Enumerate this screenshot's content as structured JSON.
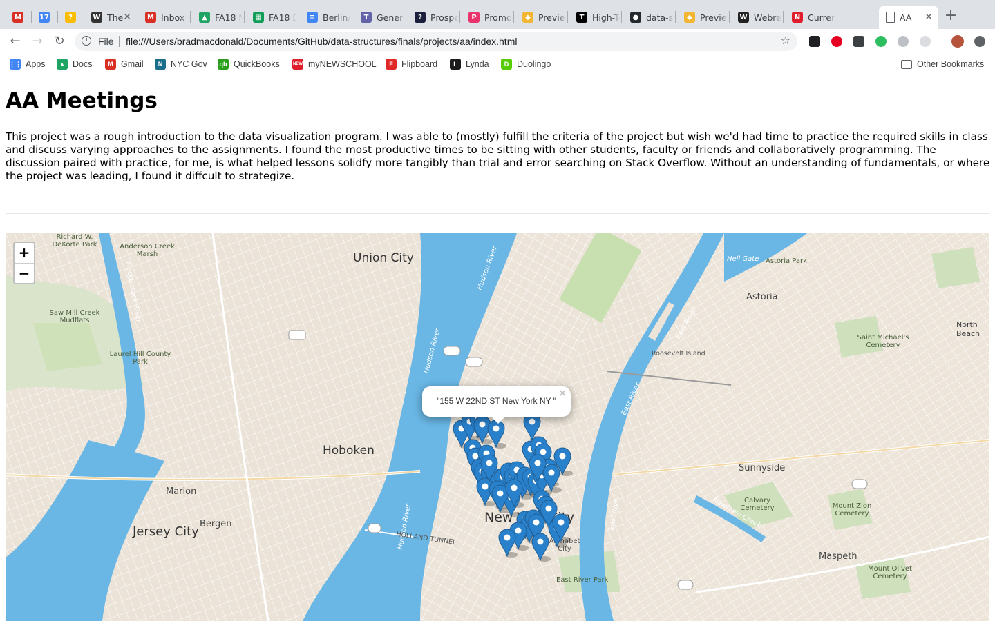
{
  "browser": {
    "tabs": [
      {
        "title": "",
        "icon": "gmail-icon",
        "color": "#d93025",
        "glyph": "M"
      },
      {
        "title": "",
        "icon": "calendar-icon",
        "color": "#4285f4",
        "glyph": "17"
      },
      {
        "title": "",
        "icon": "keep-icon",
        "color": "#fbbc04",
        "glyph": "?"
      },
      {
        "title": "The",
        "icon": "nyt-icon",
        "color": "#333333",
        "glyph": "W"
      },
      {
        "title": "Inbox (",
        "icon": "gmail-icon",
        "color": "#d93025",
        "glyph": "M"
      },
      {
        "title": "FA18 N",
        "icon": "drive-icon",
        "color": "#1fa463",
        "glyph": "▲"
      },
      {
        "title": "FA18 D",
        "icon": "sheets-icon",
        "color": "#0f9d58",
        "glyph": "▦"
      },
      {
        "title": "Berlin/F",
        "icon": "docs-icon",
        "color": "#4285f4",
        "glyph": "≡"
      },
      {
        "title": "Genera",
        "icon": "teams-icon",
        "color": "#6264a7",
        "glyph": "T"
      },
      {
        "title": "Prospe",
        "icon": "prospect-icon",
        "color": "#1b1f3b",
        "glyph": "?"
      },
      {
        "title": "Promo",
        "icon": "promo-icon",
        "color": "#e8336d",
        "glyph": "P"
      },
      {
        "title": "Preview",
        "icon": "box-icon",
        "color": "#f2b632",
        "glyph": "◆"
      },
      {
        "title": "High-Te",
        "icon": "nyt-icon",
        "color": "#000000",
        "glyph": "T"
      },
      {
        "title": "data-st",
        "icon": "github-icon",
        "color": "#24292e",
        "glyph": "●"
      },
      {
        "title": "Preview",
        "icon": "box-icon",
        "color": "#f2b632",
        "glyph": "◆"
      },
      {
        "title": "Webrec",
        "icon": "webrecorder-icon",
        "color": "#222222",
        "glyph": "W"
      },
      {
        "title": "Current",
        "icon": "newschool-icon",
        "color": "#e01e2b",
        "glyph": "N"
      },
      {
        "title": "AA",
        "icon": "page-icon",
        "color": "#ffffff",
        "glyph": ""
      }
    ],
    "url_scheme": "File",
    "url": "file:///Users/bradmacdonald/Documents/GitHub/data-structures/finals/projects/aa/index.html",
    "bookmarks": [
      {
        "label": "Apps",
        "icon": "apps-grid-icon",
        "color": "#4285f4",
        "glyph": "⋮⋮"
      },
      {
        "label": "Docs",
        "icon": "drive-icon",
        "color": "#1fa463",
        "glyph": "▲"
      },
      {
        "label": "Gmail",
        "icon": "gmail-icon",
        "color": "#d93025",
        "glyph": "M"
      },
      {
        "label": "NYC Gov",
        "icon": "nycgov-icon",
        "color": "#1b6e8a",
        "glyph": "N"
      },
      {
        "label": "QuickBooks",
        "icon": "quickbooks-icon",
        "color": "#2ca01c",
        "glyph": "qb"
      },
      {
        "label": "myNEWSCHOOL",
        "icon": "newschool-icon",
        "color": "#e01e2b",
        "glyph": "NEW"
      },
      {
        "label": "Flipboard",
        "icon": "flipboard-icon",
        "color": "#e12828",
        "glyph": "F"
      },
      {
        "label": "Lynda",
        "icon": "lynda-icon",
        "color": "#1b1b1b",
        "glyph": "L"
      },
      {
        "label": "Duolingo",
        "icon": "duolingo-icon",
        "color": "#58cc02",
        "glyph": "D"
      }
    ],
    "other_bookmarks": "Other Bookmarks"
  },
  "page": {
    "title": "AA Meetings",
    "intro": "This project was a rough introduction to the data visualization program. I was able to (mostly) fulfill the criteria of the project but wish we'd had time to practice the required skills in class and discuss varying approaches to the assignments. I found the most productive times to be sitting with other students, faculty or friends and collaboratively programming. The discussion paired with practice, for me, is what helped lessons solidfy more tangibly than trial and error searching on Stack Overflow. Without an understanding of fundamentals, or where the project was leading, I found it diffcult to strategize."
  },
  "map": {
    "zoom_in": "+",
    "zoom_out": "−",
    "popup_text": "\"155 W 22ND ST New York NY \"",
    "popup_close": "×",
    "marker_color": "#2a81cb",
    "marker_count": 48,
    "labels": {
      "union_city": "Union City",
      "hoboken": "Hoboken",
      "jersey_city": "Jersey City",
      "new_york_city": "New York City",
      "astoria": "Astoria",
      "sunnyside": "Sunnyside",
      "maspeth": "Maspeth",
      "marion": "Marion",
      "bergen": "Bergen",
      "roosevelt_island": "Roosevelt Island",
      "hudson_river": "Hudson River",
      "east_river": "East River",
      "newtown_creek": "Newtown Creek",
      "hackensack_river": "Hackensack River",
      "saw_mill_creek": "Saw Mill Creek Mudflats",
      "laurel_hill": "Laurel Hill County Park",
      "anderson_creek": "Anderson Creek Marsh",
      "richard_dekorte": "Richard W. DeKorte Park",
      "calvary": "Calvary Cemetery",
      "mount_zion": "Mount Zion Cemetery",
      "mount_olivet": "Mount Olivet Cemetery",
      "st_michaels": "Saint Michael's Cemetery",
      "astoria_park": "Astoria Park",
      "hell_gate": "Hell Gate",
      "east_river_park": "East River Park",
      "north_beach": "North Beach",
      "holland_tunnel": "HOLLAND TUNNEL",
      "alphabet_city": "Alphabet City"
    }
  }
}
